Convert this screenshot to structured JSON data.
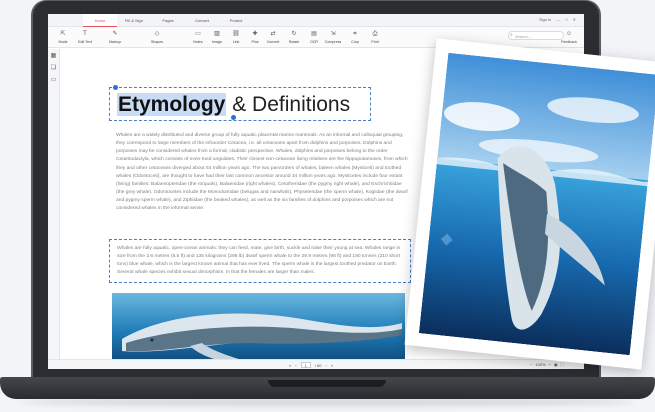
{
  "window": {
    "tabs": [
      "Home",
      "Fill & Sign",
      "Pages",
      "Convert",
      "Protect"
    ],
    "active_tab": 0,
    "controls": [
      "Sign in",
      "—",
      "□",
      "✕"
    ]
  },
  "toolbar": {
    "tools": [
      "Mode",
      "Edit Text",
      "Markup",
      "Shapes",
      "Notes",
      "Image",
      "Link",
      "Plus",
      "Convert",
      "Rotate",
      "OCR",
      "Compress",
      "Crop",
      "Print"
    ],
    "search_placeholder": "Search...",
    "feedback_label": "Feedback"
  },
  "document": {
    "heading_selected": "Etymology",
    "heading_rest": "& Definitions",
    "paragraph1": "Whales are a widely distributed and diverse group of fully aquatic placental marine mammals. As an informal and colloquial grouping, they correspond to large members of the infraorder Cetacea, i.e. all cetaceans apart from dolphins and porpoises. Dolphins and porpoises may be considered whales from a formal, cladistic perspective. Whales, dolphins and porpoises belong to the order Cetartiodactyla, which consists of even-toed ungulates. Their closest non-cetacean living relatives are the hippopotamuses, from which they and other cetaceans diverged about 54 million years ago. The two parvorders of whales, baleen whales (Mysticeti) and toothed whales (Odontoceti), are thought to have had their last common ancestor around 34 million years ago. Mysticetes include four extant (living) families: Balaenopteridae (the rorquals), Balaenidae (right whales), Cetotheriidae (the pygmy right whale), and Eschrichtiidae (the grey whale). Odontocetes include the Monodontidae (belugas and narwhals), Physeteridae (the sperm whale), Kogiidae (the dwarf and pygmy sperm whale), and Ziphiidae (the beaked whales), as well as the six families of dolphins and porpoises which are not considered whales in the informal sense.",
    "paragraph2": "Whales are fully aquatic, open-ocean animals: they can feed, mate, give birth, suckle and raise their young at sea. Whales range in size from the 2.6 metres (8.5 ft) and 135 kilograms (298 lb) dwarf sperm whale to the 29.9 metres (98 ft) and 190 tonnes (210 short tons) blue whale, which is the largest known animal that has ever lived. The sperm whale is the largest toothed predator on Earth. Several whale species exhibit sexual dimorphism, in that the females are larger than males."
  },
  "status": {
    "page_current": "1",
    "page_total": "/ 80",
    "zoom": "100%"
  },
  "colors": {
    "accent": "#e8505b",
    "selection": "#c9dcf5",
    "frame": "#4a7fc0"
  }
}
